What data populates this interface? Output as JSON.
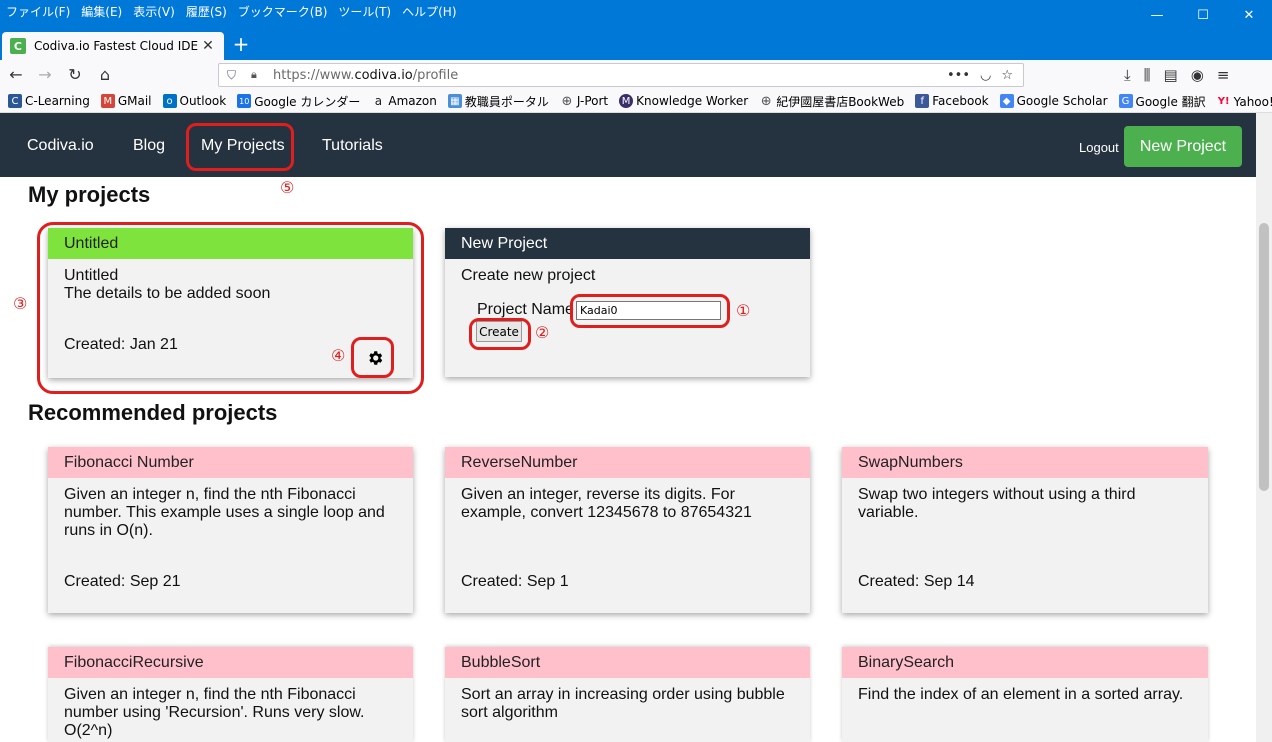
{
  "browser": {
    "menu": [
      "ファイル(F)",
      "編集(E)",
      "表示(V)",
      "履歴(S)",
      "ブックマーク(B)",
      "ツール(T)",
      "ヘルプ(H)"
    ],
    "window_controls": {
      "minimize": "—",
      "maximize": "☐",
      "close": "✕"
    },
    "tab": {
      "title": "Codiva.io Fastest Cloud IDE",
      "favicon": "C",
      "close": "✕"
    },
    "new_tab": "+",
    "url": {
      "prefix": "https://www.",
      "domain": "codiva.io",
      "path": "/profile"
    },
    "url_icons": [
      "more-icon",
      "pocket-icon",
      "star-icon"
    ],
    "toolbar_icons": [
      "download-icon",
      "library-icon",
      "sidebar-icon",
      "account-icon",
      "menu-icon"
    ],
    "bookmarks": [
      {
        "label": "C-Learning",
        "icon": "c-learning-icon",
        "color": "#2b5797"
      },
      {
        "label": "GMail",
        "icon": "gmail-icon",
        "color": "#d44638"
      },
      {
        "label": "Outlook",
        "icon": "outlook-icon",
        "color": "#0072c6"
      },
      {
        "label": "Google カレンダー",
        "icon": "calendar-icon",
        "color": "#1a73e8"
      },
      {
        "label": "Amazon",
        "icon": "amazon-icon",
        "color": "#222222"
      },
      {
        "label": "教職員ポータル",
        "icon": "portal-icon",
        "color": "#4a90d9"
      },
      {
        "label": "J-Port",
        "icon": "globe-icon",
        "color": "#555555"
      },
      {
        "label": "Knowledge Worker",
        "icon": "kw-icon",
        "color": "#3a2d6b"
      },
      {
        "label": "紀伊國屋書店BookWeb",
        "icon": "globe-icon",
        "color": "#555555"
      },
      {
        "label": "Facebook",
        "icon": "facebook-icon",
        "color": "#3b5998"
      },
      {
        "label": "Google Scholar",
        "icon": "scholar-icon",
        "color": "#4285f4"
      },
      {
        "label": "Google 翻訳",
        "icon": "translate-icon",
        "color": "#4285f4"
      },
      {
        "label": "Yahoo!路線",
        "icon": "yahoo-icon",
        "color": "#ff0033"
      }
    ],
    "bookmarks_overflow": "≫"
  },
  "site": {
    "brand": "Codiva.io",
    "nav": [
      "Blog",
      "My Projects",
      "Tutorials"
    ],
    "logout": "Logout",
    "new_project": "New Project"
  },
  "my_projects": {
    "heading": "My projects",
    "project": {
      "title": "Untitled",
      "name": "Untitled",
      "details": "The details to be added soon",
      "created": "Created: Jan 21"
    },
    "new_project_card": {
      "title": "New Project",
      "subtitle": "Create new project",
      "label": "Project Name",
      "value": "Kadai0",
      "button": "Create"
    }
  },
  "recommended": {
    "heading": "Recommended projects",
    "items": [
      {
        "title": "Fibonacci Number",
        "description": "Given an integer n, find the nth Fibonacci number. This example uses a single loop and runs in O(n).",
        "created": "Created: Sep 21"
      },
      {
        "title": "ReverseNumber",
        "description": "Given an integer, reverse its digits. For example, convert 12345678 to 87654321",
        "created": "Created: Sep 1"
      },
      {
        "title": "SwapNumbers",
        "description": "Swap two integers without using a third variable.",
        "created": "Created: Sep 14"
      },
      {
        "title": "FibonacciRecursive",
        "description": "Given an integer n, find the nth Fibonacci number using 'Recursion'. Runs very slow. O(2^n)",
        "created": ""
      },
      {
        "title": "BubbleSort",
        "description": "Sort an array in increasing order using bubble sort algorithm",
        "created": ""
      },
      {
        "title": "BinarySearch",
        "description": "Find the index of an element in a sorted array.",
        "created": ""
      }
    ]
  },
  "annotations": {
    "n1": "①",
    "n2": "②",
    "n3": "③",
    "n4": "④",
    "n5": "⑤"
  },
  "colors": {
    "nav_bg": "#253240",
    "new_project_green": "#4cb04f",
    "own_project_head": "#7fe33e",
    "recommended_head": "#ffc0cb",
    "annotation_red": "#e01e1e",
    "browser_blue": "#0078d7"
  }
}
